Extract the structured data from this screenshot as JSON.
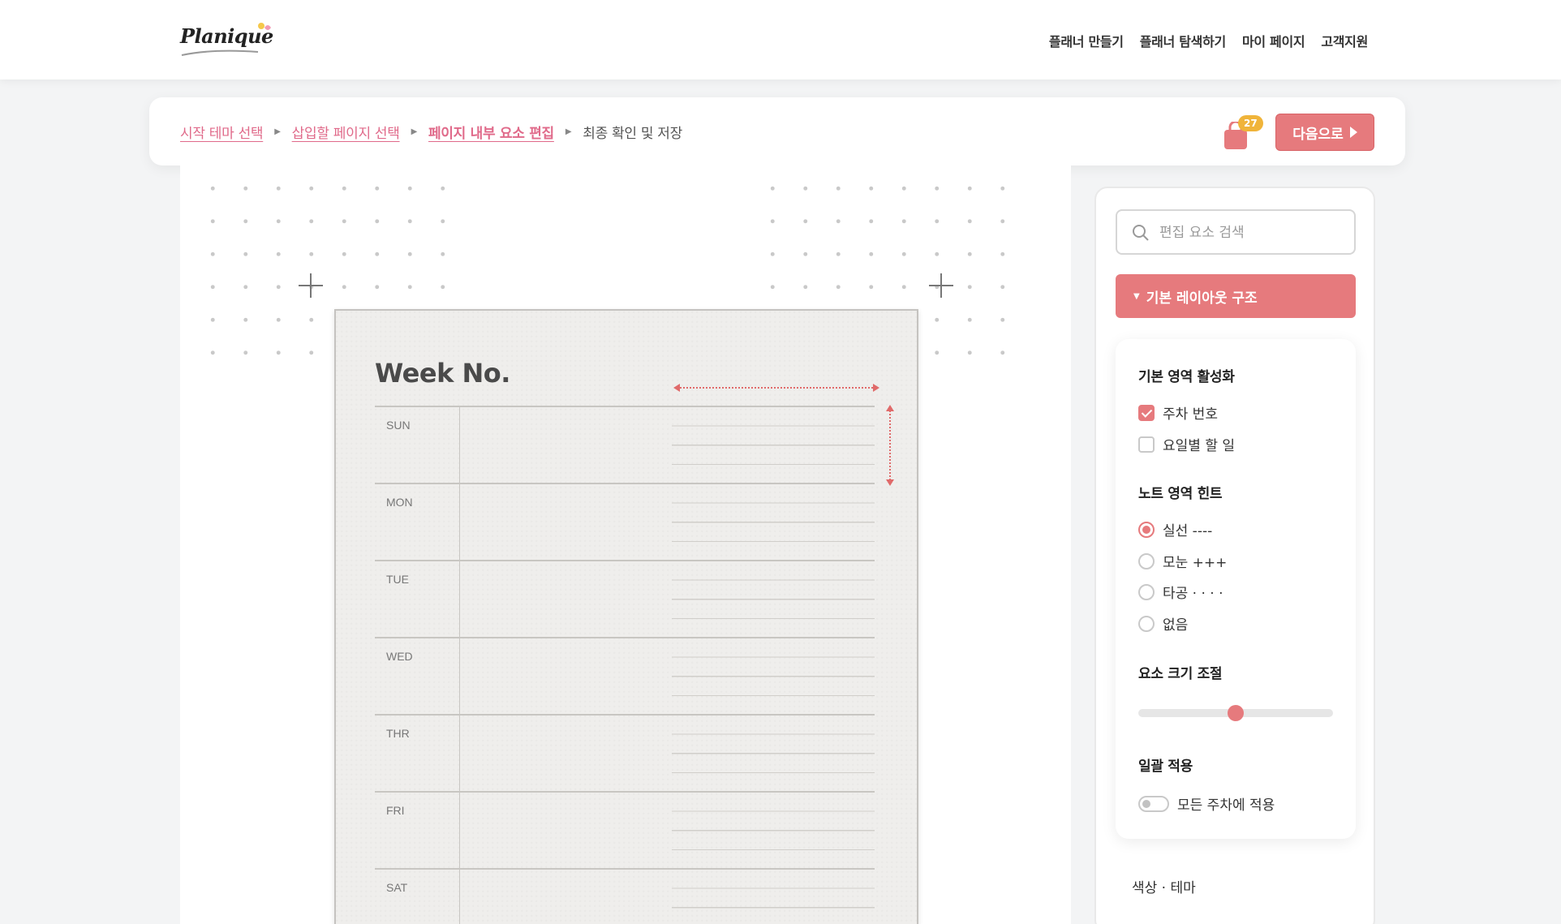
{
  "header": {
    "logo_text": "Planique",
    "nav": [
      "플래너 만들기",
      "플래너 탐색하기",
      "마이 페이지",
      "고객지원"
    ]
  },
  "steps": {
    "items": [
      "시작 테마 선택",
      "삽입할 페이지 선택",
      "페이지 내부 요소 편집",
      "최종 확인 및 저장"
    ],
    "current_index": 2,
    "cart_count": "27",
    "next_label": "다음으로"
  },
  "planner": {
    "title": "Week No.",
    "days": [
      "SUN",
      "MON",
      "TUE",
      "WED",
      "THR",
      "FRI",
      "SAT"
    ]
  },
  "panel": {
    "search_placeholder": "편집 요소 검색",
    "accordion_title": "기본 레이아웃 구조",
    "section_areas": {
      "title": "기본 영역 활성화",
      "options": [
        {
          "label": "주차 번호",
          "checked": true
        },
        {
          "label": "요일별 할 일",
          "checked": false
        }
      ]
    },
    "section_hint": {
      "title": "노트 영역 힌트",
      "options": [
        {
          "label": "실선 ----",
          "selected": true
        },
        {
          "label": "모눈 +++",
          "selected": false
        },
        {
          "label": "타공 · · · ·",
          "selected": false
        },
        {
          "label": "없음",
          "selected": false
        }
      ]
    },
    "section_size": {
      "title": "요소 크기 조절",
      "value_fraction": 0.5
    },
    "section_apply": {
      "title": "일괄 적용",
      "toggle_label": "모든 주차에 적용",
      "toggle_on": false
    },
    "next_section": "색상 · 테마"
  },
  "colors": {
    "accent": "#e67a7d",
    "step_link": "#e06a8a",
    "badge": "#f0b43a"
  }
}
